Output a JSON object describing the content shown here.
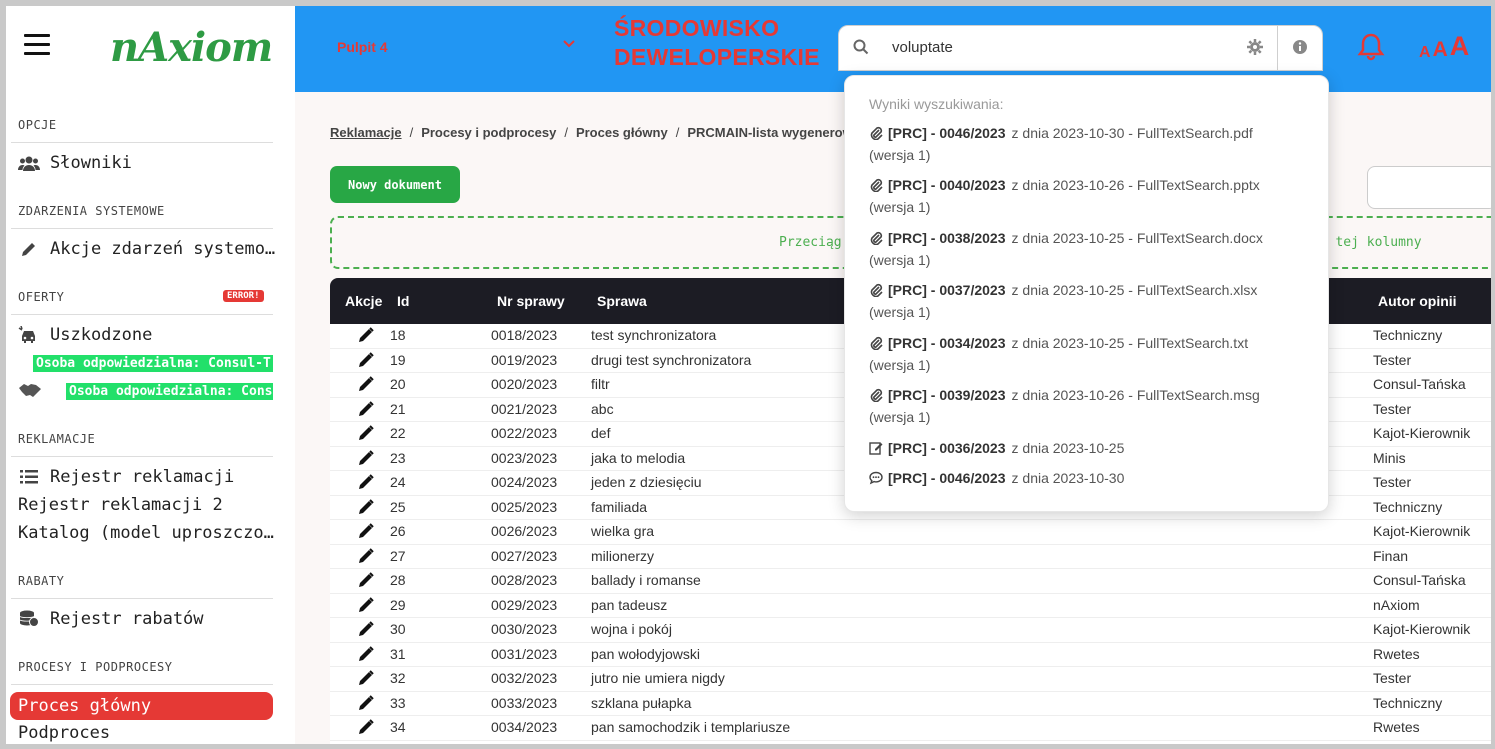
{
  "sidebar": {
    "logo": "nAxiom",
    "sections": {
      "opcje": "OPCJE",
      "zdarzenia": "ZDARZENIA SYSTEMOWE",
      "oferty": "OFERTY",
      "reklamacje": "REKLAMACJE",
      "rabaty": "RABATY",
      "procesy": "PROCESY I PODPROCESY"
    },
    "items": {
      "slowniki": "Słowniki",
      "akcje": "Akcje zdarzeń systemo…",
      "uszkodzone": "Uszkodzone",
      "osoba1": "Osoba odpowiedzialna: Consul-T",
      "osoba2": "Osoba odpowiedzialna: Cons",
      "rejestr_reklamacji": "Rejestr reklamacji",
      "rejestr_reklamacji_2": "Rejestr reklamacji 2",
      "katalog": "Katalog (model uproszczo…",
      "rejestr_rabatow": "Rejestr rabatów",
      "proces_glowny": "Proces główny",
      "podproces": "Podproces"
    },
    "error_badge": "ERROR!"
  },
  "header": {
    "pulpit": "Pulpit 4",
    "env_line1": "ŚRODOWISKO",
    "env_line2": "DEWELOPERSKIE",
    "search_value": "voluptate",
    "font_sizes": [
      "A",
      "A",
      "A"
    ]
  },
  "breadcrumb": {
    "items": [
      "Reklamacje",
      "Procesy i podprocesy",
      "Proces główny",
      "PRCMAIN-lista wygenerowa"
    ]
  },
  "toolbar": {
    "new_document": "Nowy dokument",
    "drop_left": "Przeciąg",
    "drop_right": "ug tej kolumny"
  },
  "table": {
    "headers": {
      "akcje": "Akcje",
      "id": "Id",
      "nr_sprawy": "Nr sprawy",
      "sprawa": "Sprawa",
      "autor": "Autor opinii"
    },
    "rows": [
      {
        "id": "18",
        "nr": "0018/2023",
        "sprawa": "test synchronizatora",
        "autor": "Techniczny"
      },
      {
        "id": "19",
        "nr": "0019/2023",
        "sprawa": "drugi test synchronizatora",
        "autor": "Tester"
      },
      {
        "id": "20",
        "nr": "0020/2023",
        "sprawa": "filtr",
        "autor": "Consul-Tańska"
      },
      {
        "id": "21",
        "nr": "0021/2023",
        "sprawa": "abc",
        "autor": "Tester"
      },
      {
        "id": "22",
        "nr": "0022/2023",
        "sprawa": "def",
        "autor": "Kajot-Kierownik"
      },
      {
        "id": "23",
        "nr": "0023/2023",
        "sprawa": "jaka to melodia",
        "autor": "Minis"
      },
      {
        "id": "24",
        "nr": "0024/2023",
        "sprawa": "jeden z dziesięciu",
        "autor": "Tester"
      },
      {
        "id": "25",
        "nr": "0025/2023",
        "sprawa": "familiada",
        "autor": "Techniczny"
      },
      {
        "id": "26",
        "nr": "0026/2023",
        "sprawa": "wielka gra",
        "autor": "Kajot-Kierownik"
      },
      {
        "id": "27",
        "nr": "0027/2023",
        "sprawa": "milionerzy",
        "autor": "Finan"
      },
      {
        "id": "28",
        "nr": "0028/2023",
        "sprawa": "ballady i romanse",
        "autor": "Consul-Tańska"
      },
      {
        "id": "29",
        "nr": "0029/2023",
        "sprawa": "pan tadeusz",
        "autor": "nAxiom"
      },
      {
        "id": "30",
        "nr": "0030/2023",
        "sprawa": "wojna i pokój",
        "autor": "Kajot-Kierownik"
      },
      {
        "id": "31",
        "nr": "0031/2023",
        "sprawa": "pan wołodyjowski",
        "autor": "Rwetes"
      },
      {
        "id": "32",
        "nr": "0032/2023",
        "sprawa": "jutro nie umiera nigdy",
        "autor": "Tester"
      },
      {
        "id": "33",
        "nr": "0033/2023",
        "sprawa": "szklana pułapka",
        "autor": "Techniczny"
      },
      {
        "id": "34",
        "nr": "0034/2023",
        "sprawa": "pan samochodzik i templariusze",
        "autor": "Rwetes"
      }
    ]
  },
  "search_results": {
    "title": "Wyniki wyszukiwania:",
    "items": [
      {
        "icon": "paperclip-icon",
        "ref": "[PRC] - 0046/2023",
        "line1": "z dnia 2023-10-30  - FullTextSearch.pdf",
        "line2": "(wersja 1)"
      },
      {
        "icon": "paperclip-icon",
        "ref": "[PRC] - 0040/2023",
        "line1": "z dnia 2023-10-26  - FullTextSearch.pptx",
        "line2": "(wersja 1)"
      },
      {
        "icon": "paperclip-icon",
        "ref": "[PRC] - 0038/2023",
        "line1": "z dnia 2023-10-25  - FullTextSearch.docx",
        "line2": "(wersja 1)"
      },
      {
        "icon": "paperclip-icon",
        "ref": "[PRC] - 0037/2023",
        "line1": "z dnia 2023-10-25  - FullTextSearch.xlsx",
        "line2": "(wersja 1)"
      },
      {
        "icon": "paperclip-icon",
        "ref": "[PRC] - 0034/2023",
        "line1": "z dnia 2023-10-25  - FullTextSearch.txt",
        "line2": "(wersja 1)"
      },
      {
        "icon": "paperclip-icon",
        "ref": "[PRC] - 0039/2023",
        "line1": "z dnia 2023-10-26  - FullTextSearch.msg",
        "line2": "(wersja 1)"
      },
      {
        "icon": "edit-icon",
        "ref": "[PRC] - 0036/2023",
        "line1": "z dnia 2023-10-25",
        "line2": ""
      },
      {
        "icon": "comment-icon",
        "ref": "[PRC] - 0046/2023",
        "line1": "z dnia 2023-10-30",
        "line2": ""
      }
    ]
  },
  "colors": {
    "topbar": "#2196f3",
    "accent_red": "#e53935",
    "green": "#28a745",
    "table_header": "#1c1c24"
  }
}
